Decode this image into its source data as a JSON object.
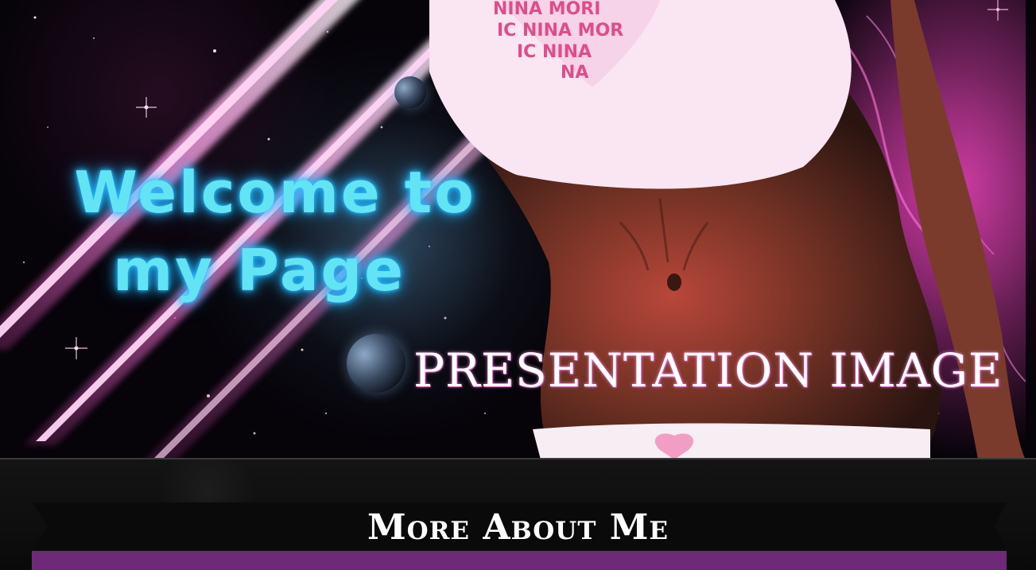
{
  "hero": {
    "welcome_line1": "Welcome to",
    "welcome_line2": "my Page",
    "presentation": "PRESENTATION IMAGE",
    "colors": {
      "welcome_text": "#63e4f5",
      "beam": "#ff66d8",
      "background": "#060309"
    }
  },
  "section": {
    "title": "More About Me",
    "bar_color": "#6e2a78"
  }
}
